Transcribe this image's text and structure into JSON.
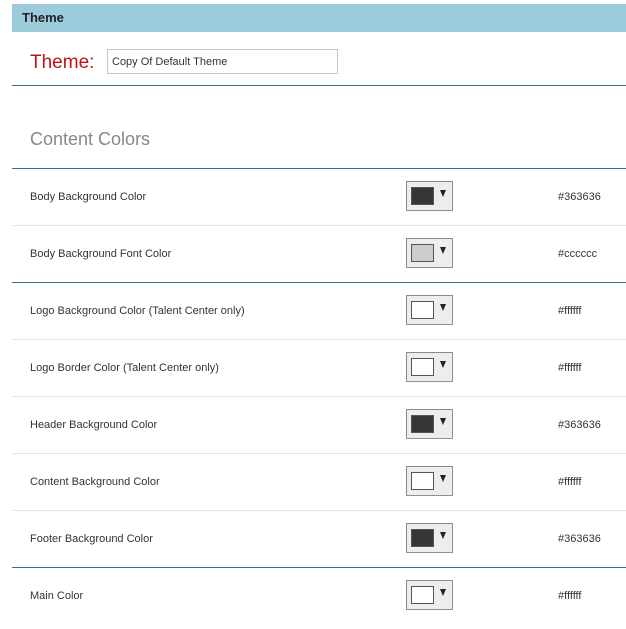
{
  "panel": {
    "title": "Theme"
  },
  "theme": {
    "label": "Theme:",
    "name_value": "Copy Of Default Theme"
  },
  "content_colors": {
    "title": "Content Colors",
    "rows": [
      {
        "label": "Body Background Color",
        "hex": "#363636",
        "color": "#363636",
        "group_start": true
      },
      {
        "label": "Body Background Font Color",
        "hex": "#cccccc",
        "color": "#cccccc",
        "group_start": false
      },
      {
        "label": "Logo Background Color (Talent Center only)",
        "hex": "#ffffff",
        "color": "#ffffff",
        "group_start": true
      },
      {
        "label": "Logo Border Color (Talent Center only)",
        "hex": "#ffffff",
        "color": "#ffffff",
        "group_start": false
      },
      {
        "label": "Header Background Color",
        "hex": "#363636",
        "color": "#363636",
        "group_start": false
      },
      {
        "label": "Content Background Color",
        "hex": "#ffffff",
        "color": "#ffffff",
        "group_start": false
      },
      {
        "label": "Footer Background Color",
        "hex": "#363636",
        "color": "#363636",
        "group_start": false
      },
      {
        "label": "Main Color",
        "hex": "#ffffff",
        "color": "#ffffff",
        "group_start": true
      }
    ]
  },
  "colors": {
    "header_bg": "#9ccbdc",
    "theme_label": "#c0141b",
    "divider": "#3b6f8c"
  }
}
